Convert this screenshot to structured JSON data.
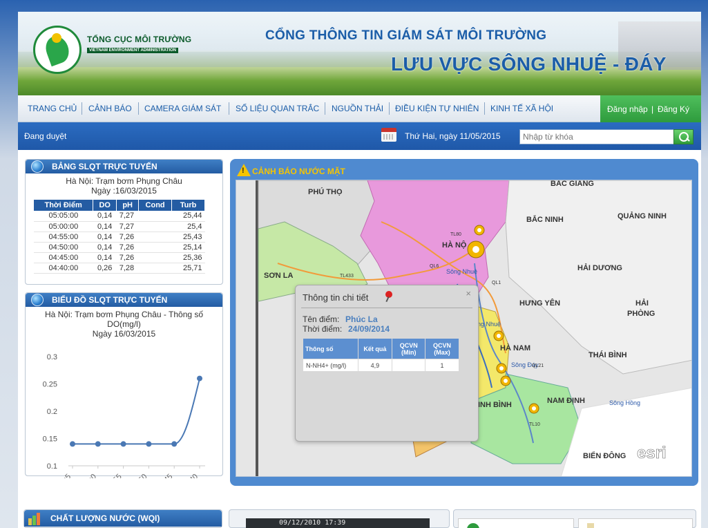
{
  "header": {
    "org_name": "TỔNG CỤC MÔI TRƯỜNG",
    "org_sub": "VIETNAM ENVIRONMENT ADMINISTRATION",
    "title": "CỔNG THÔNG TIN GIÁM SÁT MÔI TRƯỜNG",
    "subtitle": "LƯU VỰC SÔNG NHUỆ - ĐÁY"
  },
  "nav": {
    "items": [
      {
        "label": "TRANG CHỦ"
      },
      {
        "label": "CẢNH BÁO"
      },
      {
        "label": "CAMERA GIÁM SÁT"
      },
      {
        "label": "SỐ LIỆU QUAN TRẮC"
      },
      {
        "label": "NGUỒN THẢI"
      },
      {
        "label": "ĐIỀU KIỆN TỰ NHIÊN"
      },
      {
        "label": "KINH TẾ XÃ HỘI"
      }
    ],
    "login": "Đăng nhập",
    "login_sep": "|",
    "register": "Đăng Ký"
  },
  "subbar": {
    "browse": "Đang duyệt",
    "date": "Thứ Hai, ngày 11/05/2015",
    "search_placeholder": "Nhập từ khóa"
  },
  "slqt_table": {
    "title": "BẢNG SLQT TRỰC TUYẾN",
    "station": "Hà Nội: Trạm bơm Phụng Châu",
    "day": "Ngày :16/03/2015",
    "columns": [
      "Thời Điểm",
      "DO",
      "pH",
      "Cond",
      "Turb"
    ],
    "rows": [
      [
        "05:05:00",
        "0,14",
        "7,27",
        "",
        "25,44"
      ],
      [
        "05:00:00",
        "0,14",
        "7,27",
        "",
        "25,4"
      ],
      [
        "04:55:00",
        "0,14",
        "7,26",
        "",
        "25,43"
      ],
      [
        "04:50:00",
        "0,14",
        "7,26",
        "",
        "25,14"
      ],
      [
        "04:45:00",
        "0,14",
        "7,26",
        "",
        "25,36"
      ],
      [
        "04:40:00",
        "0,26",
        "7,28",
        "",
        "25,71"
      ]
    ]
  },
  "chart_panel": {
    "title": "BIỂU ĐỒ SLQT TRỰC TUYẾN",
    "line1": "Hà Nội: Trạm bơm Phụng Châu - Thông số",
    "line2": "DO(mg/l)",
    "line3": "Ngày 16/03/2015"
  },
  "chart_data": {
    "type": "line",
    "categories": [
      "5:5",
      "5:0",
      "4:55",
      "4:50",
      "4:45",
      "4:40"
    ],
    "series": [
      {
        "values": [
          0.14,
          0.14,
          0.14,
          0.14,
          0.14,
          0.26
        ]
      }
    ],
    "y_ticks": [
      "0.3",
      "0.25",
      "0.2",
      "0.15",
      "0.1"
    ],
    "ylim": [
      0.1,
      0.3
    ],
    "color": "#4a78b4",
    "grid": false
  },
  "map": {
    "title": "CẢNH BÁO NƯỚC MẶT",
    "labels": {
      "phu_tho": "PHÚ THỌ",
      "bac_giang": "BẮC GIANG",
      "bac_ninh": "BẮC NINH",
      "quang_ninh": "QUẢNG NINH",
      "ha_noi": "HÀ NỘ",
      "son_la": "SƠN LA",
      "hai_duong": "HẢI DƯƠNG",
      "hung_yen": "HƯNG YÊN",
      "hai": "HẢI",
      "phong": "PHÒNG",
      "thai_binh": "THÁI BÌNH",
      "ha_nam": "HÀ NAM",
      "ninh_binh": "NINH BÌNH",
      "nam_dinh": "NAM ĐỊNH",
      "bien_dong": "BIỂN ĐÔNG",
      "song_nhue": "Sông Nhuệ",
      "song_nhue2": "Sông Nhuệ",
      "song_day": "Sông Đáy",
      "song_hong": "Sông Hồng",
      "song_day2": "Sông Đáy",
      "tl433": "TL433",
      "ql6": "QL6",
      "tl80": "TL80",
      "ql1": "QL1",
      "ql21": "QL21",
      "tl10": "TL10",
      "esri_small": "POWERED BY",
      "esri": "esri"
    },
    "popup": {
      "title": "Thông tin chi tiết",
      "close": "×",
      "name_label": "Tên điểm:",
      "name_value": "Phúc La",
      "time_label": "Thời điểm:",
      "time_value": "24/09/2014",
      "columns": [
        "Thông số",
        "Kết quả",
        "QCVN (Min)",
        "QCVN (Max)"
      ],
      "rows": [
        [
          "N-NH4+ (mg/l)",
          "4,9",
          "",
          "1"
        ]
      ]
    }
  },
  "bottom": {
    "wqi_title": "CHẤT LƯỢNG NƯỚC (WQI)",
    "camera_stamp": "09/12/2010 17:39"
  }
}
